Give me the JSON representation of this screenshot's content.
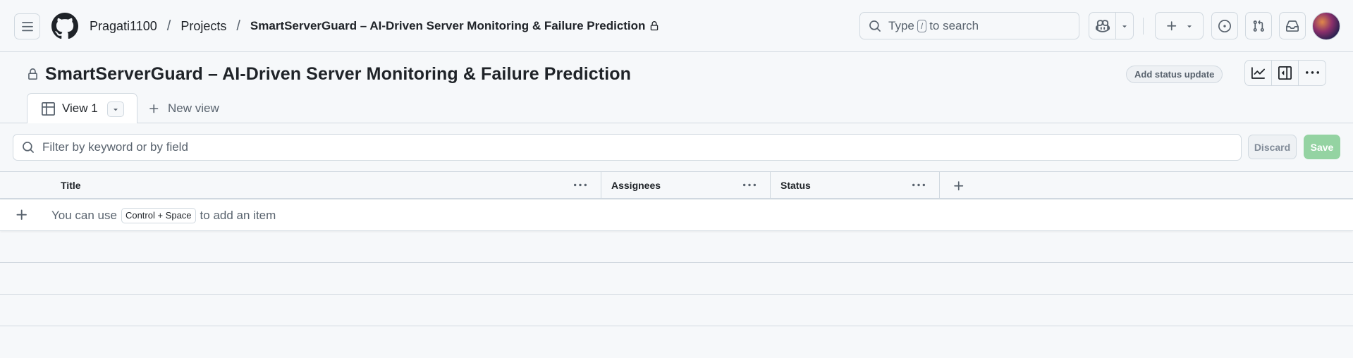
{
  "header": {
    "breadcrumbs": [
      {
        "label": "Pragati1100"
      },
      {
        "label": "Projects"
      },
      {
        "label": "SmartServerGuard – AI-Driven Server Monitoring & Failure Prediction"
      }
    ],
    "search": {
      "prefix": "Type",
      "key": "/",
      "suffix": "to search"
    },
    "icons": [
      "hamburger-icon",
      "github-logo-icon",
      "lock-icon",
      "search-icon",
      "copilot-icon",
      "chevron-down-icon",
      "plus-icon",
      "issues-icon",
      "pull-request-icon",
      "inbox-icon"
    ]
  },
  "project": {
    "title": "SmartServerGuard – AI-Driven Server Monitoring & Failure Prediction",
    "status_update_label": "Add status update",
    "toolbar_icons": [
      "insights-icon",
      "side-panel-icon",
      "kebab-icon"
    ]
  },
  "views": {
    "tabs": [
      {
        "label": "View 1",
        "icon": "table-icon",
        "active": true
      }
    ],
    "new_view_label": "New view"
  },
  "filter": {
    "placeholder": "Filter by keyword or by field",
    "discard_label": "Discard",
    "save_label": "Save"
  },
  "table": {
    "columns": [
      {
        "label": "Title"
      },
      {
        "label": "Assignees"
      },
      {
        "label": "Status"
      }
    ],
    "add_hint": {
      "prefix": "You can use",
      "shortcut": "Control + Space",
      "suffix": "to add an item"
    }
  },
  "colors": {
    "accent_save": "#94d3a2",
    "border": "#d1d9e0",
    "background": "#f6f8fa",
    "text": "#1f2328",
    "muted": "#59636e"
  }
}
